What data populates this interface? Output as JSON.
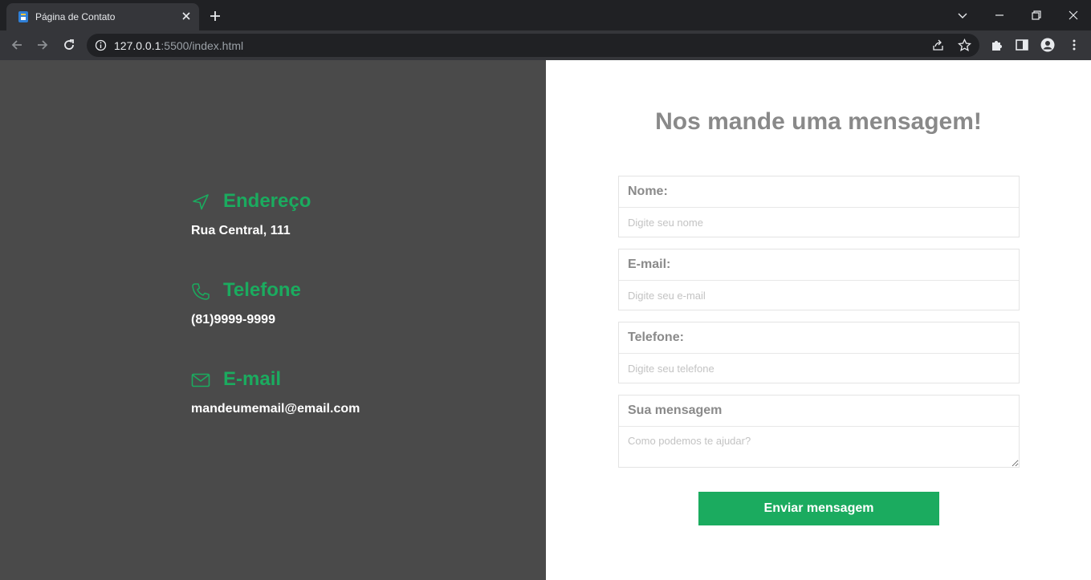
{
  "browser": {
    "tab_title": "Página de Contato",
    "url_host": "127.0.0.1",
    "url_rest": ":5500/index.html"
  },
  "contact_info": {
    "address": {
      "title": "Endereço",
      "value": "Rua Central, 111",
      "icon": "navigation-arrow-icon"
    },
    "phone": {
      "title": "Telefone",
      "value": "(81)9999-9999",
      "icon": "phone-icon"
    },
    "email": {
      "title": "E-mail",
      "value": "mandeumemail@email.com",
      "icon": "mail-icon"
    }
  },
  "form": {
    "title": "Nos mande uma mensagem!",
    "fields": [
      {
        "label": "Nome:",
        "placeholder": "Digite seu nome"
      },
      {
        "label": "E-mail:",
        "placeholder": "Digite seu e-mail"
      },
      {
        "label": "Telefone:",
        "placeholder": "Digite seu telefone"
      },
      {
        "label": "Sua mensagem",
        "placeholder": "Como podemos te ajudar?"
      }
    ],
    "submit_label": "Enviar mensagem"
  },
  "colors": {
    "accent": "#1bab5f",
    "left_panel": "#4a4a4a",
    "title_gray": "#898989"
  }
}
